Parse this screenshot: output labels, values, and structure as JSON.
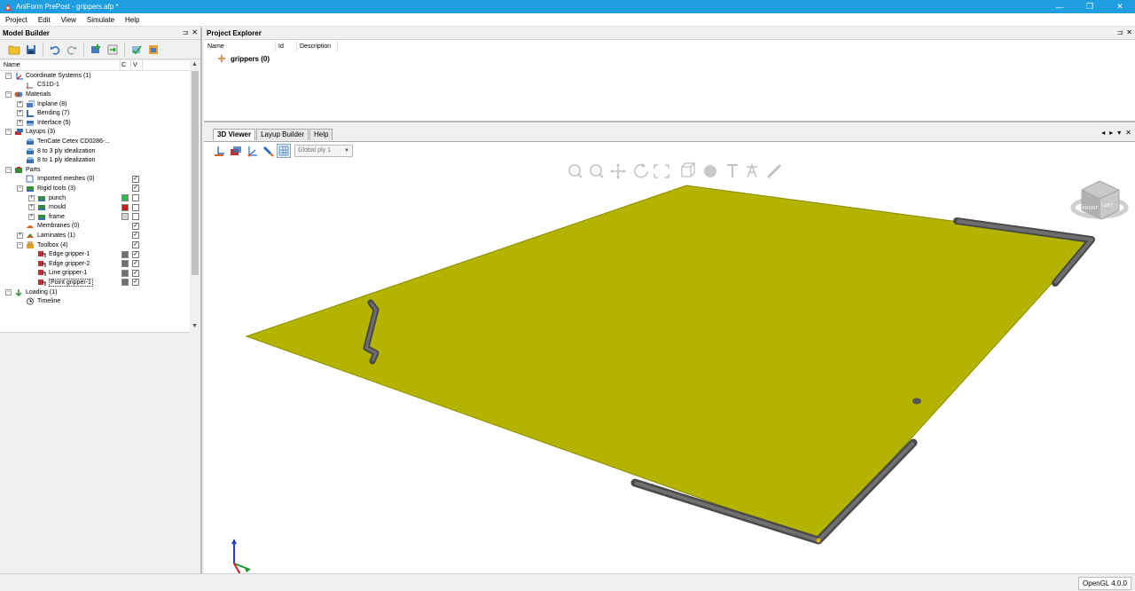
{
  "window": {
    "title": "AniForm PrePost - grippers.afp *",
    "minimize": "—",
    "maximize": "❐",
    "close": "✕"
  },
  "menu": [
    "Project",
    "Edit",
    "View",
    "Simulate",
    "Help"
  ],
  "model_builder": {
    "title": "Model Builder",
    "pin": "⊐",
    "close": "✕",
    "columns": {
      "name": "Name",
      "c": "C",
      "v": "V"
    },
    "rows": [
      {
        "label": "Coordinate Systems (1)",
        "level": 0,
        "exp": "⊟",
        "icon": "axes",
        "color": null,
        "check": null
      },
      {
        "label": "CS1D-1",
        "level": 1,
        "exp": null,
        "icon": "axes-small",
        "color": null,
        "check": null
      },
      {
        "label": "Materials",
        "level": 0,
        "exp": "⊟",
        "icon": "materials",
        "color": null,
        "check": null
      },
      {
        "label": "Inplane (8)",
        "level": 1,
        "exp": "⊞",
        "icon": "inplane",
        "color": null,
        "check": null
      },
      {
        "label": "Bending (7)",
        "level": 1,
        "exp": "⊞",
        "icon": "bending",
        "color": null,
        "check": null
      },
      {
        "label": "Interface (5)",
        "level": 1,
        "exp": "⊞",
        "icon": "interface",
        "color": null,
        "check": null
      },
      {
        "label": "Layups (3)",
        "level": 0,
        "exp": "⊟",
        "icon": "layups",
        "color": null,
        "check": null
      },
      {
        "label": "TenCate Cetex CD0286-...",
        "level": 1,
        "exp": null,
        "icon": "layup",
        "color": null,
        "check": null
      },
      {
        "label": "8 to 3 ply idealization",
        "level": 1,
        "exp": null,
        "icon": "layup",
        "color": null,
        "check": null
      },
      {
        "label": "8 to 1 ply idealization",
        "level": 1,
        "exp": null,
        "icon": "layup",
        "color": null,
        "check": null
      },
      {
        "label": "Parts",
        "level": 0,
        "exp": "⊟",
        "icon": "parts",
        "color": null,
        "check": null
      },
      {
        "label": "Imported meshes (0)",
        "level": 1,
        "exp": null,
        "icon": "mesh",
        "color": null,
        "check": "✓"
      },
      {
        "label": "Rigid tools (3)",
        "level": 1,
        "exp": "⊟",
        "icon": "rigid",
        "color": null,
        "check": "✓"
      },
      {
        "label": "punch",
        "level": 2,
        "exp": "⊞",
        "icon": "rigid",
        "color": "#2fb84a",
        "check": ""
      },
      {
        "label": "mould",
        "level": 2,
        "exp": "⊞",
        "icon": "rigid",
        "color": "#d01a1a",
        "check": ""
      },
      {
        "label": "frame",
        "level": 2,
        "exp": "⊞",
        "icon": "rigid",
        "color": "#d4d4d4",
        "check": ""
      },
      {
        "label": "Membranes (0)",
        "level": 1,
        "exp": null,
        "icon": "membrane",
        "color": null,
        "check": "✓"
      },
      {
        "label": "Laminates (1)",
        "level": 1,
        "exp": "⊞",
        "icon": "laminate",
        "color": null,
        "check": "✓"
      },
      {
        "label": "Toolbox (4)",
        "level": 1,
        "exp": "⊟",
        "icon": "toolbox",
        "color": null,
        "check": "✓"
      },
      {
        "label": "Edge gripper-1",
        "level": 2,
        "exp": null,
        "icon": "gripper",
        "color": "#707070",
        "check": "✓"
      },
      {
        "label": "Edge gripper-2",
        "level": 2,
        "exp": null,
        "icon": "gripper",
        "color": "#707070",
        "check": "✓"
      },
      {
        "label": "Line gripper-1",
        "level": 2,
        "exp": null,
        "icon": "gripper",
        "color": "#707070",
        "check": "✓"
      },
      {
        "label": "Point gripper-1",
        "level": 2,
        "exp": null,
        "icon": "gripper",
        "color": "#707070",
        "check": "✓",
        "selected": true
      },
      {
        "label": "Loading (1)",
        "level": 0,
        "exp": "⊟",
        "icon": "loading",
        "color": null,
        "check": null
      },
      {
        "label": "Timeline",
        "level": 1,
        "exp": null,
        "icon": "timeline",
        "color": null,
        "check": null
      }
    ]
  },
  "project_explorer": {
    "title": "Project Explorer",
    "pin": "⊐",
    "close": "✕",
    "columns": {
      "name": "Name",
      "id": "Id",
      "description": "Description"
    },
    "root": "grippers (0)"
  },
  "viewer": {
    "tabs": [
      "3D Viewer",
      "Layup Builder",
      "Help"
    ],
    "active_tab": "3D Viewer",
    "ply_select": "Global ply 1",
    "status": "OpenGL 4.0.0",
    "ply_color": "#b3b300",
    "gripper_color": "#5a5a5a"
  }
}
